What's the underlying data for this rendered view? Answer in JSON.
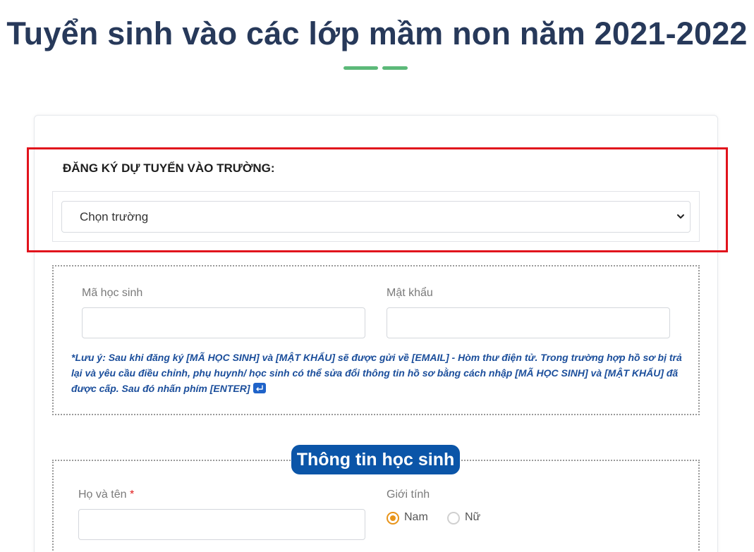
{
  "page": {
    "title": "Tuyển sinh vào các lớp mầm non năm 2021-2022"
  },
  "school_section": {
    "label": "ĐĂNG KÝ DỰ TUYỂN VÀO TRƯỜNG:",
    "select_value": "Chọn trường"
  },
  "login": {
    "student_code_label": "Mã học sinh",
    "password_label": "Mật khẩu",
    "student_code_value": "",
    "password_value": "",
    "note": "*Lưu ý: Sau khi đăng ký [MÃ HỌC SINH] và [MẬT KHẨU] sẽ được gửi về [EMAIL] - Hòm thư điện tử. Trong trường hợp hồ sơ bị trả lại và yêu cầu điều chỉnh, phụ huynh/ học sinh có thể sửa đổi thông tin hồ sơ bằng cách nhập [MÃ HỌC SINH] và [MẬT KHẨU] đã được cấp. Sau đó nhấn phím [ENTER]"
  },
  "student_info": {
    "section_title": "Thông tin học sinh",
    "fullname_label": "Họ và tên",
    "required_mark": "*",
    "gender_label": "Giới tính",
    "gender_options": [
      "Nam",
      "Nữ"
    ],
    "gender_selected": "Nam"
  },
  "colors": {
    "title": "#27395a",
    "accent_green": "#5cb979",
    "badge_blue": "#0b55a8",
    "note_blue": "#1b4e9b",
    "highlight_red": "#e1131c",
    "radio_orange": "#e8941a"
  }
}
